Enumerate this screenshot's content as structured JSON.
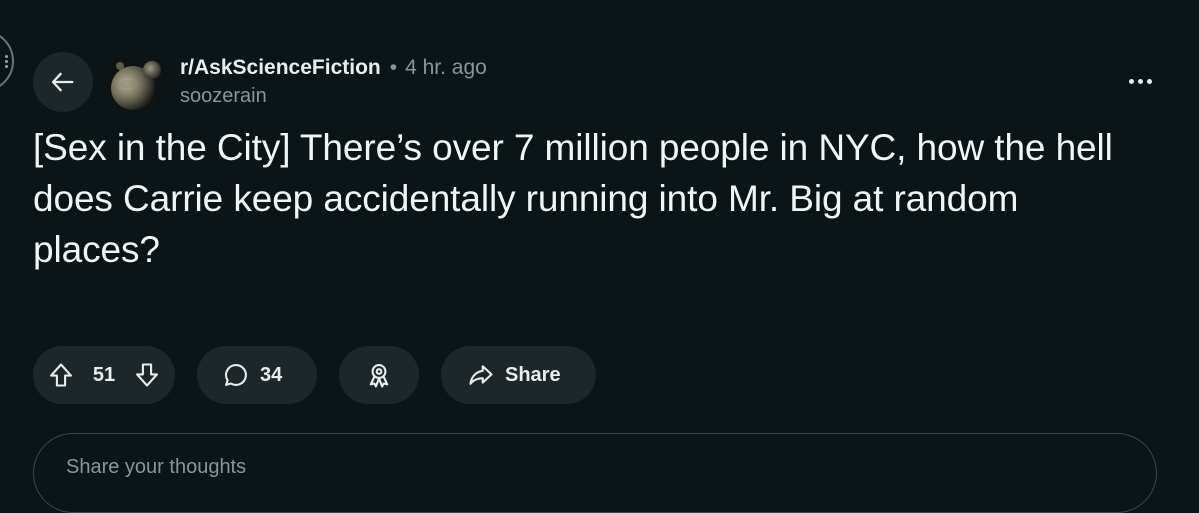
{
  "post": {
    "subreddit": "r/AskScienceFiction",
    "separator": "•",
    "time": "4 hr. ago",
    "author": "soozerain",
    "title": "[Sex in the City] There’s over 7 million people in NYC, how the hell does Carrie keep accidentally running into Mr. Big at random places?"
  },
  "actions": {
    "upvotes": "51",
    "comments": "34",
    "share_label": "Share"
  },
  "comment_box": {
    "placeholder": "Share your thoughts"
  },
  "icons": {
    "back": "arrow-left-icon",
    "overflow": "more-horizontal-icon",
    "upvote": "arrow-up-icon",
    "downvote": "arrow-down-icon",
    "comment": "speech-bubble-icon",
    "award": "award-ribbon-icon",
    "share": "share-arrow-icon"
  },
  "colors": {
    "background": "#0b1416",
    "pill": "#1d2628",
    "text": "#e8eef0",
    "muted": "#8a9599"
  }
}
